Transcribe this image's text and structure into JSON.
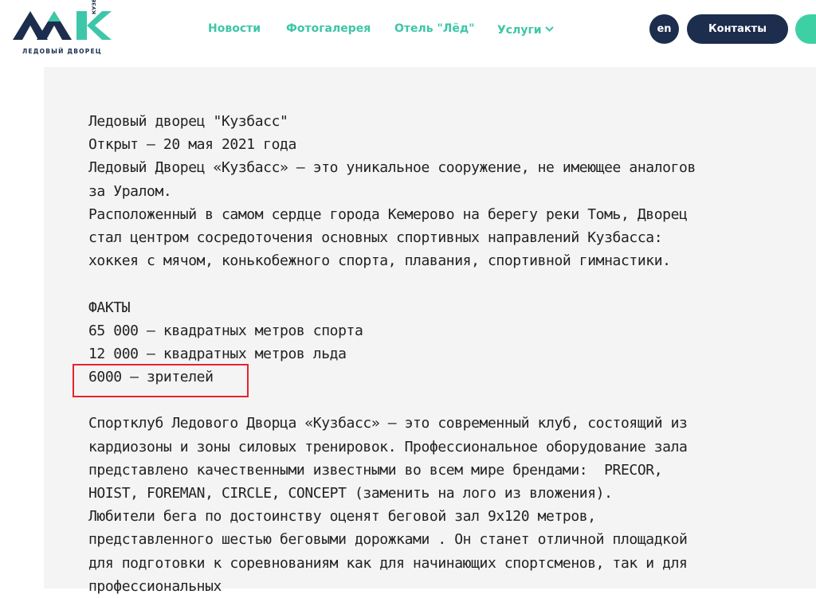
{
  "header": {
    "logo": {
      "caption": "ЛЕДОВЫЙ ДВОРЕЦ",
      "vertical_text": "КУЗБАСС",
      "colors": {
        "navy": "#1c2d4d",
        "teal": "#3ec6a8"
      }
    },
    "nav": [
      {
        "label": "Новости"
      },
      {
        "label": "Фотогалерея"
      },
      {
        "label": "Отель \"Лёд\""
      },
      {
        "label": "Услуги"
      }
    ],
    "lang_label": "en",
    "contacts_label": "Контакты",
    "accent_color": "#3ec6a8"
  },
  "article": {
    "intro": [
      "Ледовый дворец \"Кузбасс\"",
      "Открыт – 20 мая 2021 года",
      "Ледовый Дворец «Кузбасс» – это уникальное сооружение, не имеющее аналогов",
      "за Уралом.",
      "Расположенный в самом сердце города Кемерово на берегу реки Томь, Дворец",
      "стал центром сосредоточения основных спортивных направлений Кузбасса:",
      "хоккея с мячом, конькобежного спорта, плавания, спортивной гимнастики."
    ],
    "facts_heading": "ФАКТЫ",
    "facts": [
      "65 000 – квадратных метров спорта",
      "12 000 – квадратных метров льда",
      "6000 – зрителей"
    ],
    "sportclub": [
      "Спортклуб Ледового Дворца «Кузбасс» – это современный клуб, состоящий из",
      "кардиозоны и зоны силовых тренировок. Профессиональное оборудование зала",
      "представлено качественными известными во всем мире брендами:  PRECOR,",
      "HOIST, FOREMAN, CIRCLE, CONCEPT (заменить на лого из вложения).",
      "Любители бега по достоинству оценят беговой зал 9х120 метров,",
      "представленного шестью беговыми дорожками . Он станет отличной площадкой",
      "для подготовки к соревнованиям как для начинающих спортсменов, так и для",
      "профессиональных"
    ]
  },
  "highlight_color": "#e8232b"
}
